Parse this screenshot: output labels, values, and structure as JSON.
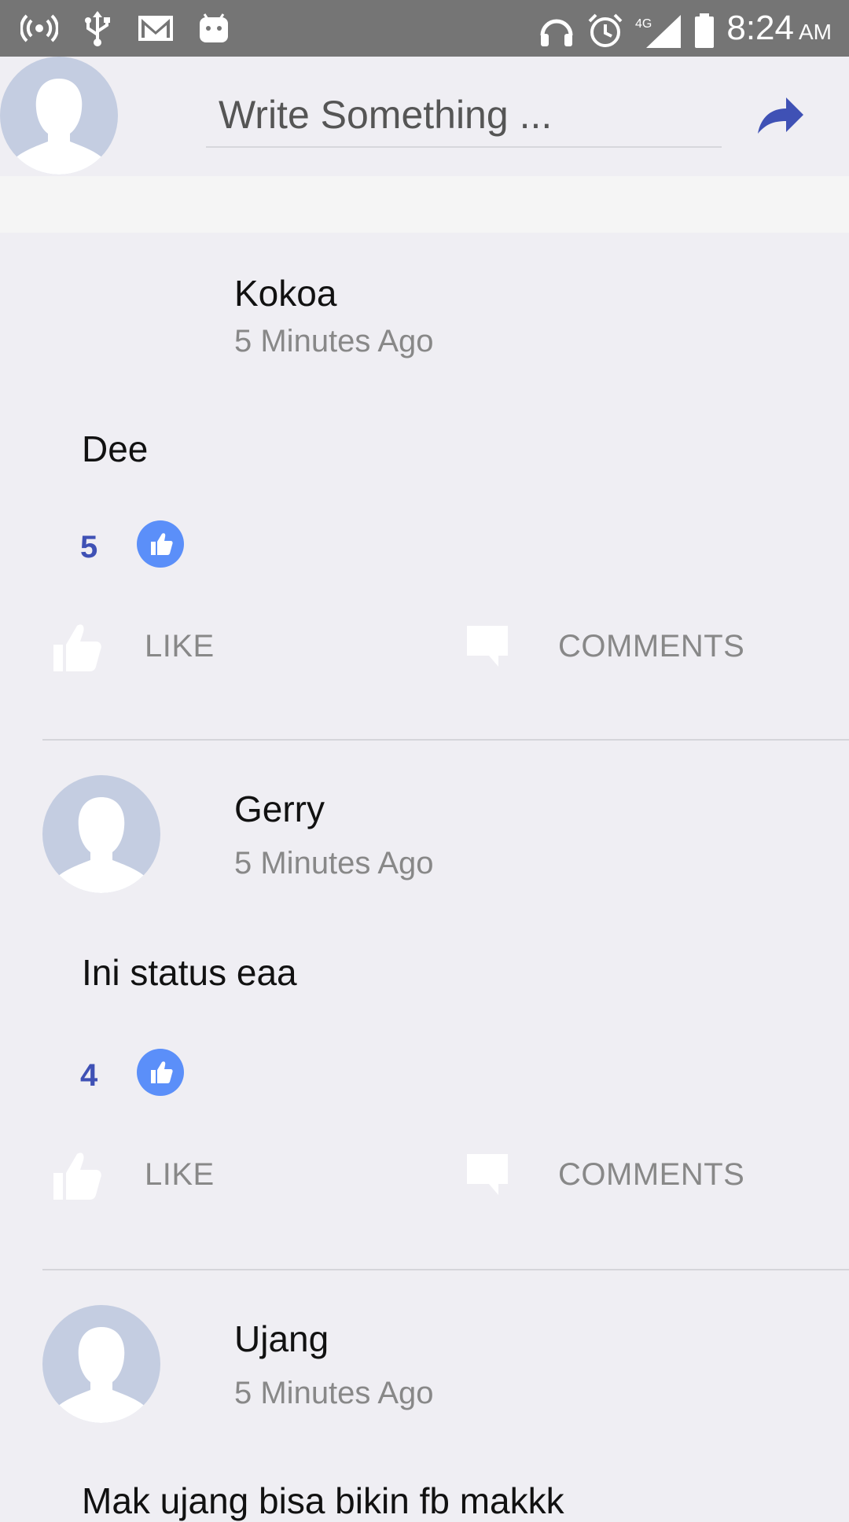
{
  "status_bar": {
    "time": "8:24",
    "ampm": "AM",
    "network": "4G",
    "icons_left": [
      "hotspot-icon",
      "usb-icon",
      "gmail-icon",
      "android-icon"
    ],
    "icons_right": [
      "headset-icon",
      "alarm-icon",
      "signal-icon",
      "battery-icon"
    ]
  },
  "composer": {
    "placeholder": "Write Something ..."
  },
  "posts": [
    {
      "name": "Kokoa",
      "time": "5 Minutes Ago",
      "text": "Dee",
      "likes": "5",
      "like_label": "LIKE",
      "comments_label": "COMMENTS",
      "show_avatar": false
    },
    {
      "name": "Gerry",
      "time": "5 Minutes Ago",
      "text": "Ini status eaa",
      "likes": "4",
      "like_label": "LIKE",
      "comments_label": "COMMENTS",
      "show_avatar": true
    },
    {
      "name": "Ujang",
      "time": "5 Minutes Ago",
      "text": "Mak ujang bisa bikin fb makkk",
      "show_avatar": true
    }
  ],
  "colors": {
    "status_bar": "#757575",
    "background": "#efeef3",
    "accent": "#3f51b5",
    "like_badge": "#5b8ff9",
    "avatar": "#c4cde1"
  }
}
